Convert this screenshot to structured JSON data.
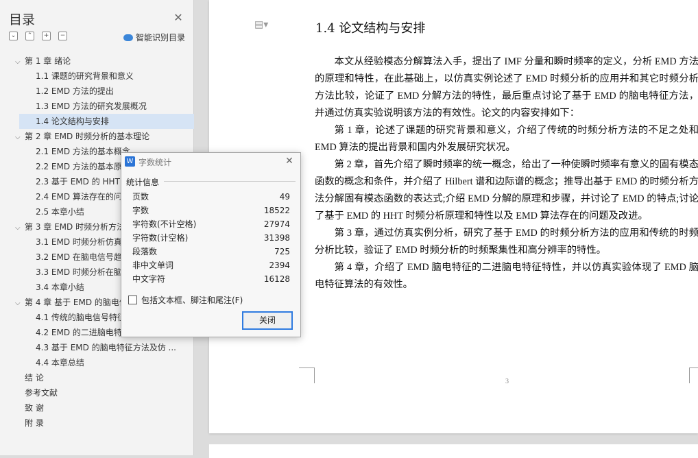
{
  "sidebar": {
    "title": "目录",
    "smart_toc_label": "智能识别目录",
    "tool_icons": [
      "collapse-all-icon",
      "expand-up-icon",
      "add-icon",
      "remove-icon"
    ],
    "items": [
      {
        "label": "第 1 章  绪论",
        "level": 1,
        "expanded": true
      },
      {
        "label": "1.1 课题的研究背景和意义",
        "level": 2
      },
      {
        "label": "1.2 EMD 方法的提出",
        "level": 2
      },
      {
        "label": "1.3 EMD 方法的研究发展概况",
        "level": 2
      },
      {
        "label": "1.4  论文结构与安排",
        "level": 2,
        "selected": true
      },
      {
        "label": "第 2 章  EMD 时频分析的基本理论",
        "level": 1,
        "expanded": true
      },
      {
        "label": "2.1 EMD 方法的基本概念",
        "level": 2
      },
      {
        "label": "2.2 EMD 方法的基本原理",
        "level": 2
      },
      {
        "label": "2.3  基于 EMD 的 HHT",
        "level": 2
      },
      {
        "label": "2.4 EMD 算法存在的问题",
        "level": 2
      },
      {
        "label": "2.5  本章小结",
        "level": 2
      },
      {
        "label": "第 3 章  EMD  时频分析方法",
        "level": 1,
        "expanded": true
      },
      {
        "label": "3.1 EMD  时频分析仿真",
        "level": 2
      },
      {
        "label": "3.2 EMD 在脑电信号趋势",
        "level": 2
      },
      {
        "label": "3.3 EMD  时频分析在脑",
        "level": 2
      },
      {
        "label": "3.4  本章小结",
        "level": 2
      },
      {
        "label": "第 4 章  基于 EMD 的脑电信号",
        "level": 1,
        "expanded": true
      },
      {
        "label": "4.1  传统的脑电信号特征",
        "level": 2
      },
      {
        "label": "4.2 EMD  的二进脑电特征",
        "level": 2
      },
      {
        "label": "4.3  基于 EMD 的脑电特征方法及仿 ...",
        "level": 2
      },
      {
        "label": "4.4 本章总结",
        "level": 2
      },
      {
        "label": "结  论",
        "level": 0
      },
      {
        "label": "参考文献",
        "level": 0
      },
      {
        "label": "致  谢",
        "level": 0
      },
      {
        "label": "附  录",
        "level": 0
      }
    ]
  },
  "document": {
    "heading": "1.4  论文结构与安排",
    "paragraphs": [
      "本文从经验模态分解算法入手，提出了 IMF 分量和瞬时频率的定义，分析 EMD 方法的原理和特性，在此基础上，以仿真实例论述了 EMD 时频分析的应用并和其它时频分析方法比较，论证了  EMD 分解方法的特性，最后重点讨论了基于  EMD 的脑电特征方法，并通过仿真实验说明该方法的有效性。论文的内容安排如下：",
      "第 1 章，论述了课题的研究背景和意义，介绍了传统的时频分析方法的不足之处和  EMD  算法的提出背景和国内外发展研究状况。",
      "第 2 章，首先介绍了瞬时频率的统一概念，给出了一种使瞬时频率有意义的固有模态函数的概念和条件，并介绍了 Hilbert 谱和边际谱的概念；推导出基于 EMD 的时频分析方法分解固有模态函数的表达式;介绍 EMD 分解的原理和步骤，并讨论了  EMD 的特点;讨论了基于 EMD 的 HHT 时频分析原理和特性以及 EMD 算法存在的问题及改进。",
      "第 3 章，通过仿真实例分析，研究了基于  EMD  的时频分析方法的应用和传统的时频分析比较，验证了 EMD 时频分析的时频聚集性和高分辨率的特性。",
      "第 4 章，介绍了 EMD 脑电特征的二进脑电特征特性，并以仿真实验体现了 EMD 脑电特征算法的有效性。"
    ],
    "page_number": "3"
  },
  "dialog": {
    "title": "字数统计",
    "section_label": "统计信息",
    "stats": [
      {
        "label": "页数",
        "value": "49"
      },
      {
        "label": "字数",
        "value": "18522"
      },
      {
        "label": "字符数(不计空格)",
        "value": "27974"
      },
      {
        "label": "字符数(计空格)",
        "value": "31398"
      },
      {
        "label": "段落数",
        "value": "725"
      },
      {
        "label": "非中文单词",
        "value": "2394"
      },
      {
        "label": "中文字符",
        "value": "16128"
      }
    ],
    "checkbox_label": "包括文本框、脚注和尾注(F)",
    "checkbox_checked": false,
    "close_button": "关闭"
  },
  "colors": {
    "selected_item": "#d6e4f5",
    "accent": "#2f7be0"
  }
}
